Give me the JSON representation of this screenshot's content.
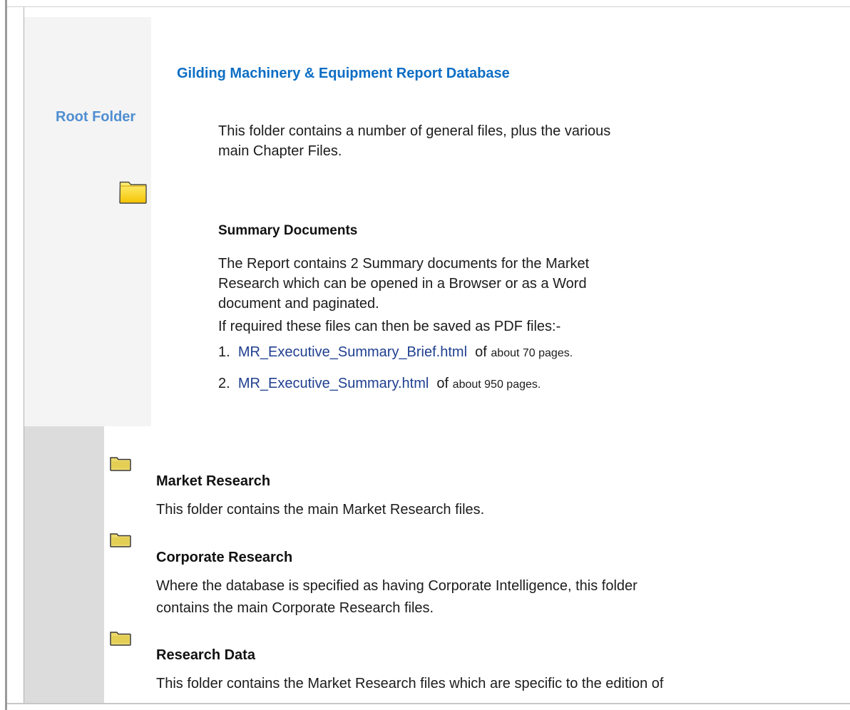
{
  "sidebar": {
    "root_folder_label": "Root Folder",
    "folder_icon": "folder-icon"
  },
  "header": {
    "title": "Gilding Machinery & Equipment Report Database"
  },
  "intro": {
    "text": "This folder contains a number of general files, plus the various main Chapter Files."
  },
  "summary": {
    "heading": "Summary Documents",
    "description": "The Report contains 2 Summary documents for the Market Research which can be opened in a Browser or as a Word document and paginated.",
    "pdf_note": "If required these files can then be saved as PDF files:-",
    "documents": [
      {
        "number": "1.",
        "link": "MR_Executive_Summary_Brief.html",
        "of": "of",
        "pages": "about 70 pages."
      },
      {
        "number": "2.",
        "link": "MR_Executive_Summary.html",
        "of": "of",
        "pages": "about 950 pages."
      }
    ]
  },
  "folders": [
    {
      "icon": "folder-icon",
      "title": "Market Research",
      "description": "This folder contains the main Market Research files."
    },
    {
      "icon": "folder-icon",
      "title": "Corporate Research",
      "description": "Where the database is specified as having Corporate Intelligence, this folder contains the main Corporate Research files."
    },
    {
      "icon": "folder-icon",
      "title": "Research Data",
      "description": "This folder contains the Market Research files which are specific to the edition of"
    }
  ],
  "colors": {
    "title_blue": "#0d6ec4",
    "root_label_blue": "#4f8ed1",
    "link_blue": "#1f3f8f",
    "folder_yellow": "#ffd800"
  }
}
